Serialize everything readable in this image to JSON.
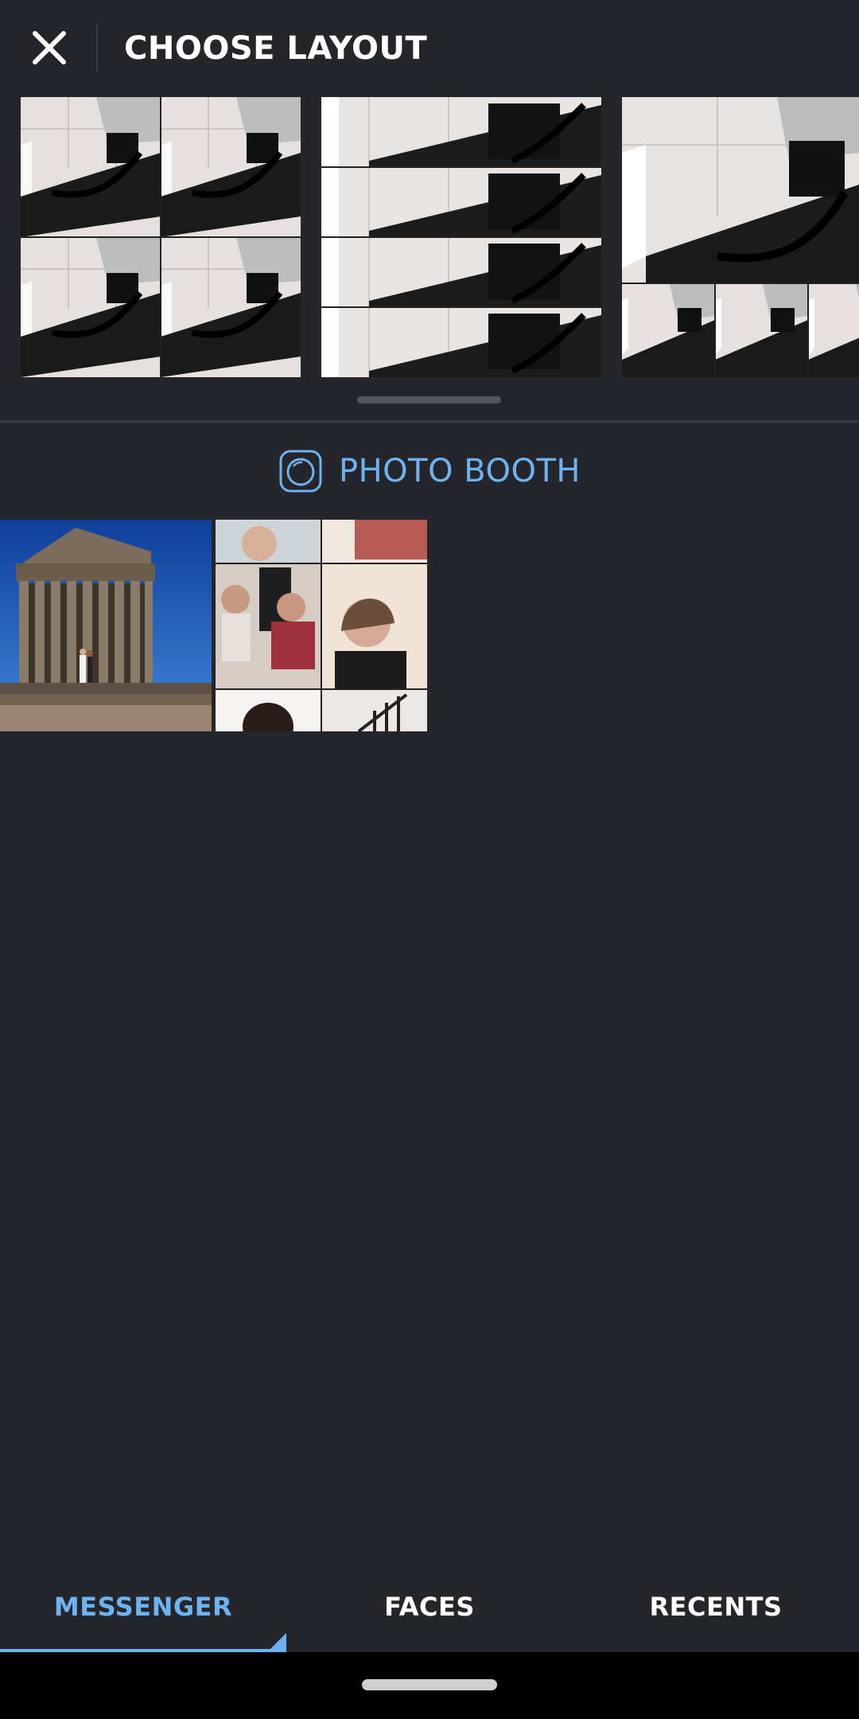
{
  "header": {
    "title": "CHOOSE LAYOUT",
    "close_icon": "close-icon"
  },
  "layouts": [
    {
      "name": "grid-2x2"
    },
    {
      "name": "stack-4-rows"
    },
    {
      "name": "1-top-3-bottom"
    }
  ],
  "photo_booth": {
    "label": "PHOTO BOOTH",
    "icon": "camera-lens-icon"
  },
  "gallery": [
    {
      "name": "temple-photo"
    },
    {
      "name": "video-call-collage"
    }
  ],
  "tabs": [
    {
      "label": "MESSENGER",
      "active": true
    },
    {
      "label": "FACES",
      "active": false
    },
    {
      "label": "RECENTS",
      "active": false
    }
  ],
  "colors": {
    "background": "#25262b",
    "accent": "#6db3f2",
    "text": "#ffffff",
    "navbar": "#000000"
  }
}
